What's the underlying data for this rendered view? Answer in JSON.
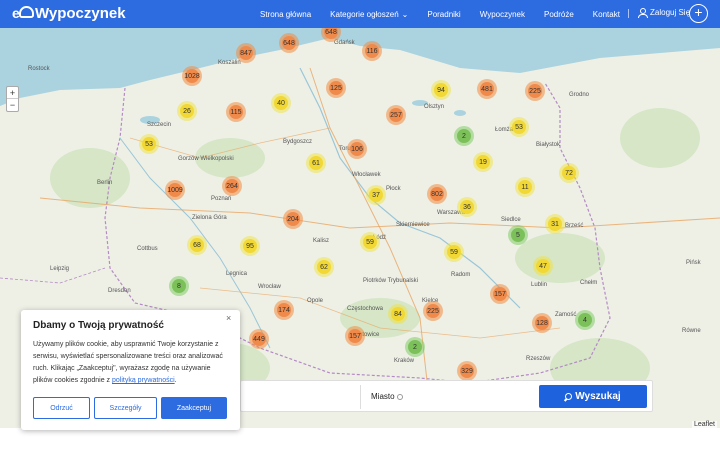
{
  "header": {
    "logo_text": "Wypoczynek",
    "logo_prefix": "e",
    "nav": [
      "Strona główna",
      "Kategorie ogłoszeń",
      "Poradniki",
      "Wypoczynek",
      "Podróże",
      "Kontakt"
    ],
    "login_label": "Zaloguj Się",
    "add_label": "+"
  },
  "map": {
    "zoom_in": "+",
    "zoom_out": "−",
    "attribution": "Leaflet",
    "cities": [
      {
        "name": "Gdańsk"
      },
      {
        "name": "Szczecin"
      },
      {
        "name": "Koszalin"
      },
      {
        "name": "Bydgoszcz"
      },
      {
        "name": "Toruń"
      },
      {
        "name": "Olsztyn"
      },
      {
        "name": "Białystok"
      },
      {
        "name": "Łomża"
      },
      {
        "name": "Grodno"
      },
      {
        "name": "Berlin"
      },
      {
        "name": "Poznań"
      },
      {
        "name": "Gorzów Wielkopolski"
      },
      {
        "name": "Zielona Góra"
      },
      {
        "name": "Kalisz"
      },
      {
        "name": "Łódź"
      },
      {
        "name": "Warszawa"
      },
      {
        "name": "Siedlce"
      },
      {
        "name": "Brześć"
      },
      {
        "name": "Radom"
      },
      {
        "name": "Lublin"
      },
      {
        "name": "Kielce"
      },
      {
        "name": "Częstochowa"
      },
      {
        "name": "Wrocław"
      },
      {
        "name": "Opole"
      },
      {
        "name": "Katowice"
      },
      {
        "name": "Kraków"
      },
      {
        "name": "Rzeszów"
      },
      {
        "name": "Dresden"
      },
      {
        "name": "Leipzig"
      },
      {
        "name": "Rostock"
      },
      {
        "name": "Płock"
      },
      {
        "name": "Włocławek"
      },
      {
        "name": "Skierniewice"
      },
      {
        "name": "Chełm"
      },
      {
        "name": "Cottbus"
      },
      {
        "name": "Legnica"
      },
      {
        "name": "Zamość"
      },
      {
        "name": "Piotrków Trybunalski"
      },
      {
        "name": "Pińsk"
      },
      {
        "name": "Równe"
      }
    ],
    "clusters": [
      {
        "label": "648",
        "color": "o"
      },
      {
        "label": "847",
        "color": "o"
      },
      {
        "label": "116",
        "color": "o"
      },
      {
        "label": "1028",
        "color": "o"
      },
      {
        "label": "26",
        "color": "y"
      },
      {
        "label": "115",
        "color": "o"
      },
      {
        "label": "40",
        "color": "y"
      },
      {
        "label": "125",
        "color": "o"
      },
      {
        "label": "94",
        "color": "y"
      },
      {
        "label": "481",
        "color": "o"
      },
      {
        "label": "225",
        "color": "o"
      },
      {
        "label": "257",
        "color": "o"
      },
      {
        "label": "53",
        "color": "y"
      },
      {
        "label": "2",
        "color": "g"
      },
      {
        "label": "53",
        "color": "y"
      },
      {
        "label": "61",
        "color": "y"
      },
      {
        "label": "106",
        "color": "o"
      },
      {
        "label": "19",
        "color": "y"
      },
      {
        "label": "72",
        "color": "y"
      },
      {
        "label": "264",
        "color": "o"
      },
      {
        "label": "37",
        "color": "y"
      },
      {
        "label": "802",
        "color": "o"
      },
      {
        "label": "11",
        "color": "y"
      },
      {
        "label": "36",
        "color": "y"
      },
      {
        "label": "204",
        "color": "o"
      },
      {
        "label": "31",
        "color": "y"
      },
      {
        "label": "5",
        "color": "g"
      },
      {
        "label": "68",
        "color": "y"
      },
      {
        "label": "95",
        "color": "y"
      },
      {
        "label": "59",
        "color": "y"
      },
      {
        "label": "59",
        "color": "y"
      },
      {
        "label": "62",
        "color": "y"
      },
      {
        "label": "47",
        "color": "y"
      },
      {
        "label": "8",
        "color": "g"
      },
      {
        "label": "157",
        "color": "o"
      },
      {
        "label": "174",
        "color": "o"
      },
      {
        "label": "84",
        "color": "y"
      },
      {
        "label": "225",
        "color": "o"
      },
      {
        "label": "128",
        "color": "o"
      },
      {
        "label": "4",
        "color": "g"
      },
      {
        "label": "449",
        "color": "o"
      },
      {
        "label": "157",
        "color": "o"
      },
      {
        "label": "2",
        "color": "g"
      },
      {
        "label": "329",
        "color": "o"
      },
      {
        "label": "648",
        "color": "o"
      },
      {
        "label": "1009",
        "color": "o"
      }
    ]
  },
  "search": {
    "city_label": "Miasto",
    "button_label": "Wyszukaj"
  },
  "cookie": {
    "title": "Dbamy o Twoją prywatność",
    "text": "Używamy plików cookie, aby usprawnić Twoje korzystanie z serwisu, wyświetlać spersonalizowane treści oraz analizować ruch. Klikając „Zaakceptuj\", wyrażasz zgodę na używanie plików cookies zgodnie z ",
    "link": "polityką prywatności",
    "text_end": ".",
    "close": "×",
    "buttons": [
      "Odrzuć",
      "Szczegóły",
      "Zaakceptuj"
    ],
    "btn_reject": "Odrzuć",
    "btn_details": "Szczegóły",
    "btn_accept": "Zaakceptuj"
  },
  "colors": {
    "brand": "#2d6be0",
    "cluster_orange": "#f08a4b",
    "cluster_yellow": "#f1d835",
    "cluster_green": "#7cc05a"
  }
}
